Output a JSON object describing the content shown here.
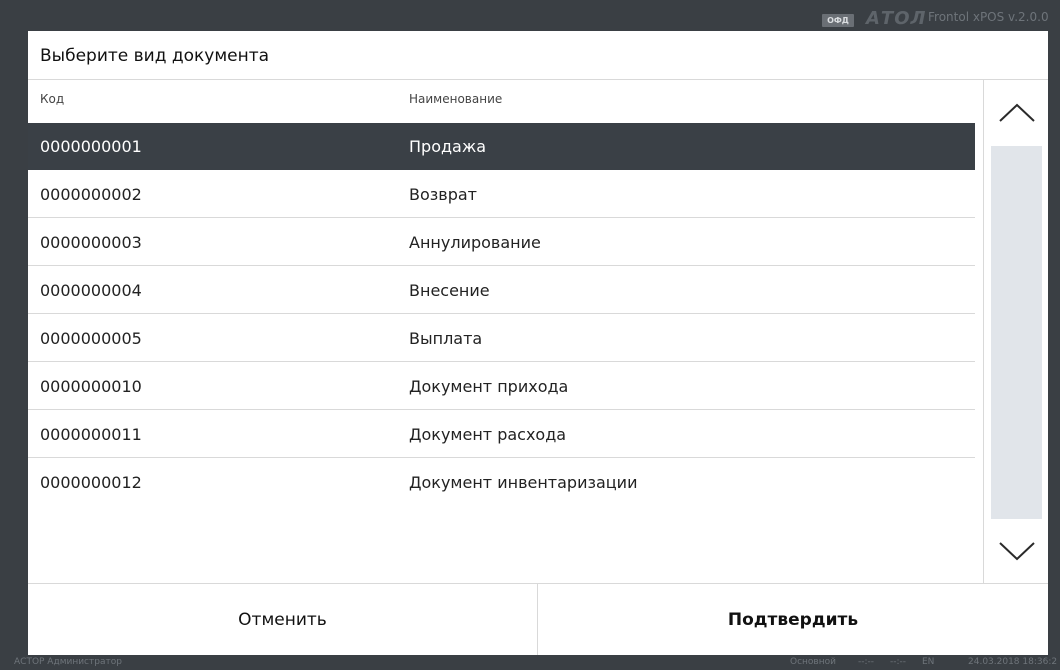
{
  "topbar": {
    "ofd_badge": "ОФД",
    "logo": "АТОЛ",
    "version": "Frontol xPOS v.2.0.0"
  },
  "dialog": {
    "title": "Выберите вид документа",
    "columns": {
      "code": "Код",
      "name": "Наименование"
    },
    "rows": [
      {
        "code": "0000000001",
        "name": "Продажа",
        "selected": true
      },
      {
        "code": "0000000002",
        "name": "Возврат"
      },
      {
        "code": "0000000003",
        "name": "Аннулирование"
      },
      {
        "code": "0000000004",
        "name": "Внесение"
      },
      {
        "code": "0000000005",
        "name": "Выплата"
      },
      {
        "code": "0000000010",
        "name": "Документ прихода"
      },
      {
        "code": "0000000011",
        "name": "Документ расхода"
      },
      {
        "code": "0000000012",
        "name": "Документ инвентаризации"
      }
    ],
    "scroll": {
      "up_icon": "chevron-up-icon",
      "down_icon": "chevron-down-icon"
    },
    "buttons": {
      "cancel": "Отменить",
      "confirm": "Подтвердить"
    }
  },
  "statusbar": {
    "user": "АСТОР  Администратор",
    "mode": "Основной",
    "time1": "--:--",
    "time2": "--:--",
    "lang": "EN",
    "datetime": "24.03.2018 18:36:2"
  },
  "colors": {
    "background": "#3a3f44",
    "selected_row": "#3a4046",
    "scroll_track": "#e1e5ea"
  }
}
